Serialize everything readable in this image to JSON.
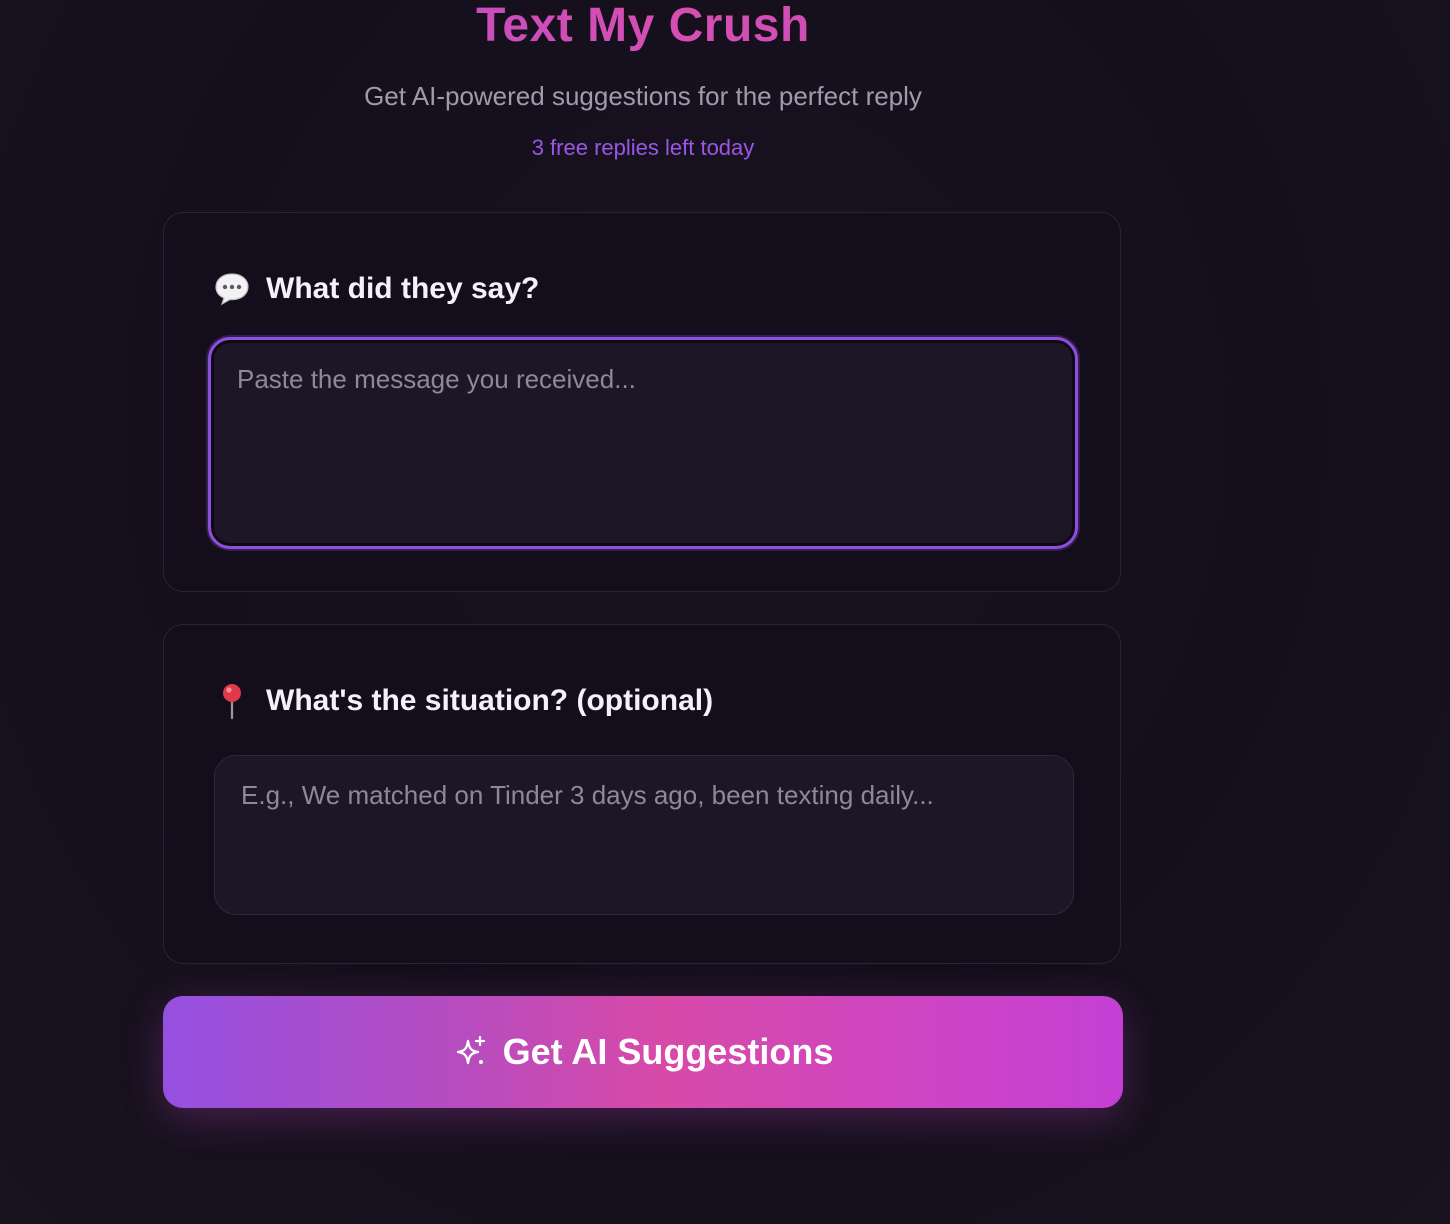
{
  "header": {
    "title": "Text My Crush",
    "subtitle": "Get AI-powered suggestions for the perfect reply",
    "free_replies": "3 free replies left today"
  },
  "message_section": {
    "icon": "speech-bubble-icon",
    "label": "What did they say?",
    "placeholder": "Paste the message you received...",
    "value": ""
  },
  "situation_section": {
    "icon": "round-pushpin-icon",
    "label": "What's the situation? (optional)",
    "placeholder": "E.g., We matched on Tinder 3 days ago, been texting daily...",
    "value": ""
  },
  "cta": {
    "icon": "sparkles-icon",
    "label": "Get AI Suggestions"
  },
  "colors": {
    "accent_purple": "#9a57e6",
    "accent_pink": "#d84aa8",
    "background": "#140f1c"
  }
}
